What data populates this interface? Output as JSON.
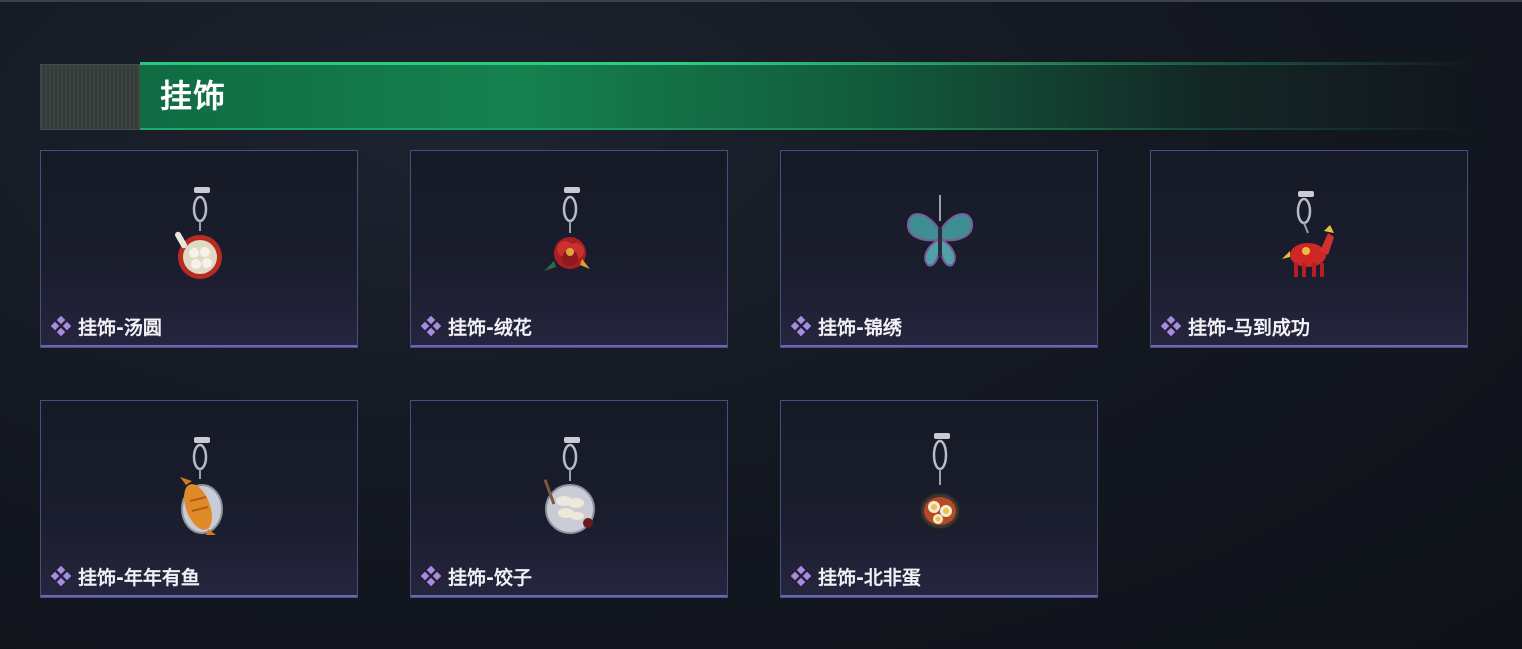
{
  "section": {
    "title": "挂饰"
  },
  "items": [
    {
      "label": "挂饰-汤圆",
      "icon": "tangyuan-bowl-charm-icon",
      "accent": "#c8352a"
    },
    {
      "label": "挂饰-绒花",
      "icon": "velvet-flower-charm-icon",
      "accent": "#b8282a"
    },
    {
      "label": "挂饰-锦绣",
      "icon": "butterfly-charm-icon",
      "accent": "#4fa3a8"
    },
    {
      "label": "挂饰-马到成功",
      "icon": "red-horse-charm-icon",
      "accent": "#d02a2a"
    },
    {
      "label": "挂饰-年年有鱼",
      "icon": "fish-plate-charm-icon",
      "accent": "#e08a2a"
    },
    {
      "label": "挂饰-饺子",
      "icon": "dumplings-plate-charm-icon",
      "accent": "#e8e2d4"
    },
    {
      "label": "挂饰-北非蛋",
      "icon": "shakshuka-pan-charm-icon",
      "accent": "#f0c340"
    }
  ],
  "colors": {
    "header_green": "#15814f",
    "card_border": "#4a4d80",
    "diamond": "#a98be0"
  }
}
